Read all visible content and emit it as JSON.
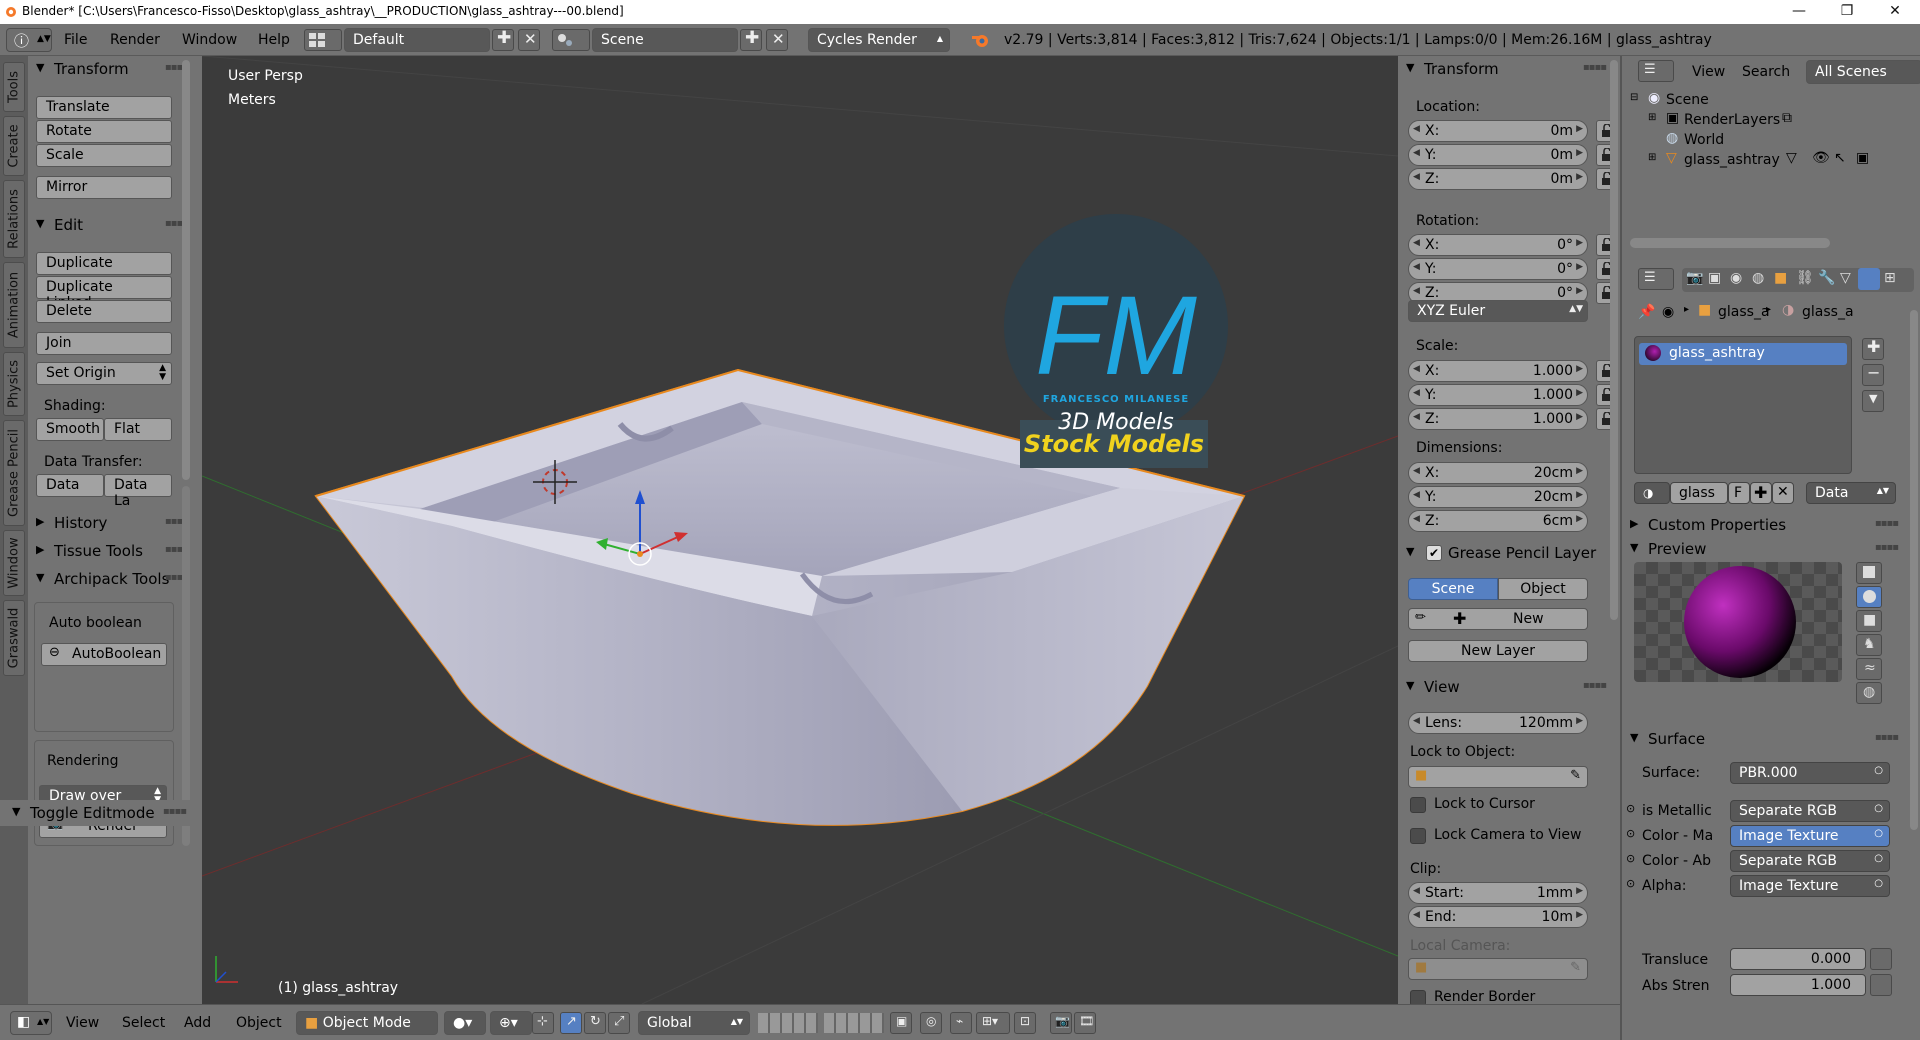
{
  "titlebar": {
    "title": "Blender* [C:\\Users\\Francesco-Fisso\\Desktop\\glass_ashtray\\__PRODUCTION\\glass_ashtray---00.blend]",
    "min": "—",
    "max": "❐",
    "close": "✕"
  },
  "header": {
    "menus": [
      "File",
      "Render",
      "Window",
      "Help"
    ],
    "layout": "Default",
    "scene": "Scene",
    "engine": "Cycles Render",
    "stats": "v2.79 | Verts:3,814 | Faces:3,812 | Tris:7,624 | Objects:1/1 | Lamps:0/0 | Mem:26.16M | glass_ashtray"
  },
  "toolshelf": {
    "tabs": [
      "Tools",
      "Create",
      "Relations",
      "Animation",
      "Physics",
      "Grease Pencil",
      "Window",
      "Graswald"
    ],
    "transform": {
      "title": "Transform",
      "buttons": [
        "Translate",
        "Rotate",
        "Scale",
        "Mirror"
      ]
    },
    "edit": {
      "title": "Edit",
      "buttons": [
        "Duplicate",
        "Duplicate Linked",
        "Delete",
        "Join"
      ],
      "set_origin": "Set Origin",
      "shading_label": "Shading:",
      "smooth": "Smooth",
      "flat": "Flat",
      "data_transfer_label": "Data Transfer:",
      "data": "Data",
      "data_la": "Data La"
    },
    "history": "History",
    "tissue": "Tissue Tools",
    "archipack": "Archipack Tools",
    "auto_boolean_label": "Auto boolean",
    "auto_boolean_btn": "AutoBoolean",
    "rendering_label": "Rendering",
    "draw_over": "Draw over",
    "render_btn": "Render",
    "toggle_editmode": "Toggle Editmode"
  },
  "viewport": {
    "view_name": "User Persp",
    "units": "Meters",
    "object_label": "(1) glass_ashtray",
    "logo_big": "FM",
    "logo_sub": "FRANCESCO MILANESE",
    "logo_3d": "3D Models",
    "banner": "Stock Models"
  },
  "npanel": {
    "transform_title": "Transform",
    "location_label": "Location:",
    "location": [
      {
        "k": "X:",
        "v": "0m"
      },
      {
        "k": "Y:",
        "v": "0m"
      },
      {
        "k": "Z:",
        "v": "0m"
      }
    ],
    "rotation_label": "Rotation:",
    "rotation": [
      {
        "k": "X:",
        "v": "0°"
      },
      {
        "k": "Y:",
        "v": "0°"
      },
      {
        "k": "Z:",
        "v": "0°"
      }
    ],
    "rotation_mode": "XYZ Euler",
    "scale_label": "Scale:",
    "scale": [
      {
        "k": "X:",
        "v": "1.000"
      },
      {
        "k": "Y:",
        "v": "1.000"
      },
      {
        "k": "Z:",
        "v": "1.000"
      }
    ],
    "dimensions_label": "Dimensions:",
    "dimensions": [
      {
        "k": "X:",
        "v": "20cm"
      },
      {
        "k": "Y:",
        "v": "20cm"
      },
      {
        "k": "Z:",
        "v": "6cm"
      }
    ],
    "grease_title": "Grease Pencil Layer",
    "gp_scene": "Scene",
    "gp_object": "Object",
    "gp_new": "New",
    "gp_new_layer": "New Layer",
    "view_title": "View",
    "lens_k": "Lens:",
    "lens_v": "120mm",
    "lock_to_object": "Lock to Object:",
    "lock_to_cursor": "Lock to Cursor",
    "lock_camera": "Lock Camera to View",
    "clip_label": "Clip:",
    "clip_start_k": "Start:",
    "clip_start_v": "1mm",
    "clip_end_k": "End:",
    "clip_end_v": "10m",
    "local_camera": "Local Camera:",
    "render_border": "Render Border"
  },
  "outliner": {
    "view": "View",
    "search": "Search",
    "all_scenes": "All Scenes",
    "items": [
      "Scene",
      "RenderLayers",
      "World",
      "glass_ashtray"
    ]
  },
  "properties": {
    "breadcrumb": [
      "glass_a",
      "glass_a"
    ],
    "material_slot": "glass_ashtray",
    "mat_name": "glass",
    "mat_f": "F",
    "data_select": "Data",
    "custom_props": "Custom Properties",
    "preview": "Preview",
    "surface_title": "Surface",
    "surface_label": "Surface:",
    "surface_value": "PBR.000",
    "rows": [
      {
        "k": "is Metallic",
        "v": "Separate RGB"
      },
      {
        "k": "Color - Ma",
        "v": "Image Texture"
      },
      {
        "k": "Color - Ab",
        "v": "Separate RGB"
      },
      {
        "k": "Alpha:",
        "v": "Image Texture"
      }
    ],
    "translucence_k": "Transluce",
    "translucence_v": "0.000",
    "abs_k": "Abs Stren",
    "abs_v": "1.000"
  },
  "bottom": {
    "menus": [
      "View",
      "Select",
      "Add",
      "Object"
    ],
    "mode": "Object Mode",
    "orientation": "Global"
  },
  "colors": {
    "accent": "#5680c2",
    "logo_blue": "#1fa6e0",
    "banner_yellow": "#f0d21e",
    "selection_orange": "#e8891e"
  }
}
